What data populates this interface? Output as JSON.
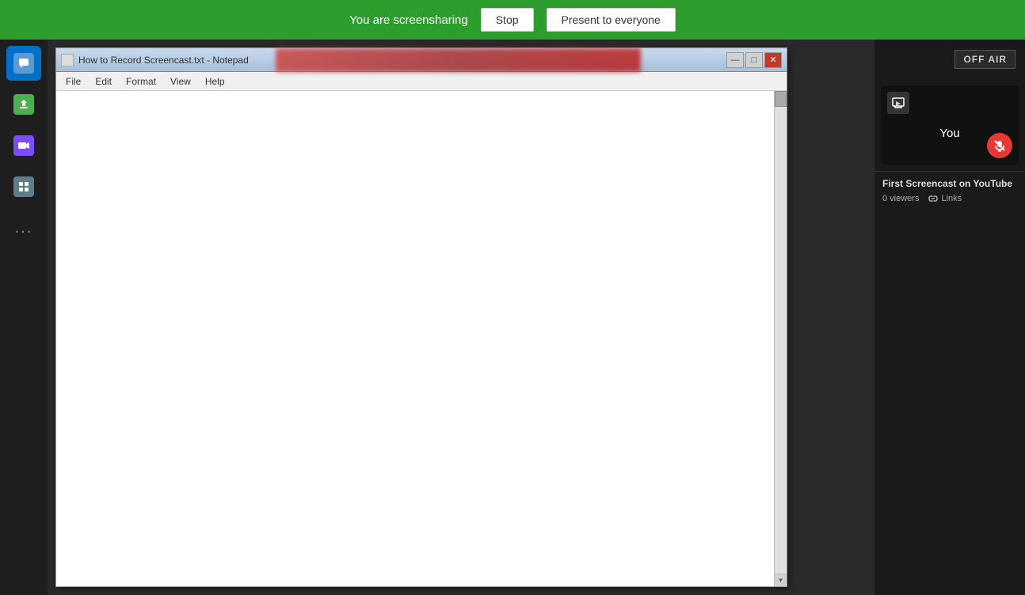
{
  "screenshare_bar": {
    "message": "You are screensharing",
    "stop_label": "Stop",
    "present_label": "Present to everyone"
  },
  "sidebar": {
    "items": [
      {
        "name": "chat",
        "label": "Chat",
        "icon": "chat-icon"
      },
      {
        "name": "share",
        "label": "Share",
        "icon": "share-icon"
      },
      {
        "name": "video",
        "label": "Video",
        "icon": "video-icon"
      },
      {
        "name": "grid",
        "label": "Grid",
        "icon": "grid-icon"
      }
    ],
    "more_label": "..."
  },
  "notepad": {
    "title": "How to Record Screencast.txt - Notepad",
    "menus": [
      "File",
      "Edit",
      "Format",
      "View",
      "Help"
    ]
  },
  "right_panel": {
    "off_air_label": "OFF AIR",
    "you_label": "You",
    "stream_title": "First Screencast on YouTube",
    "viewers": "0 viewers",
    "links_label": "Links"
  },
  "colors": {
    "green": "#2d9e2d",
    "sidebar_bg": "#1e1e1e",
    "panel_bg": "#1a1a1a",
    "red": "#e53935"
  }
}
